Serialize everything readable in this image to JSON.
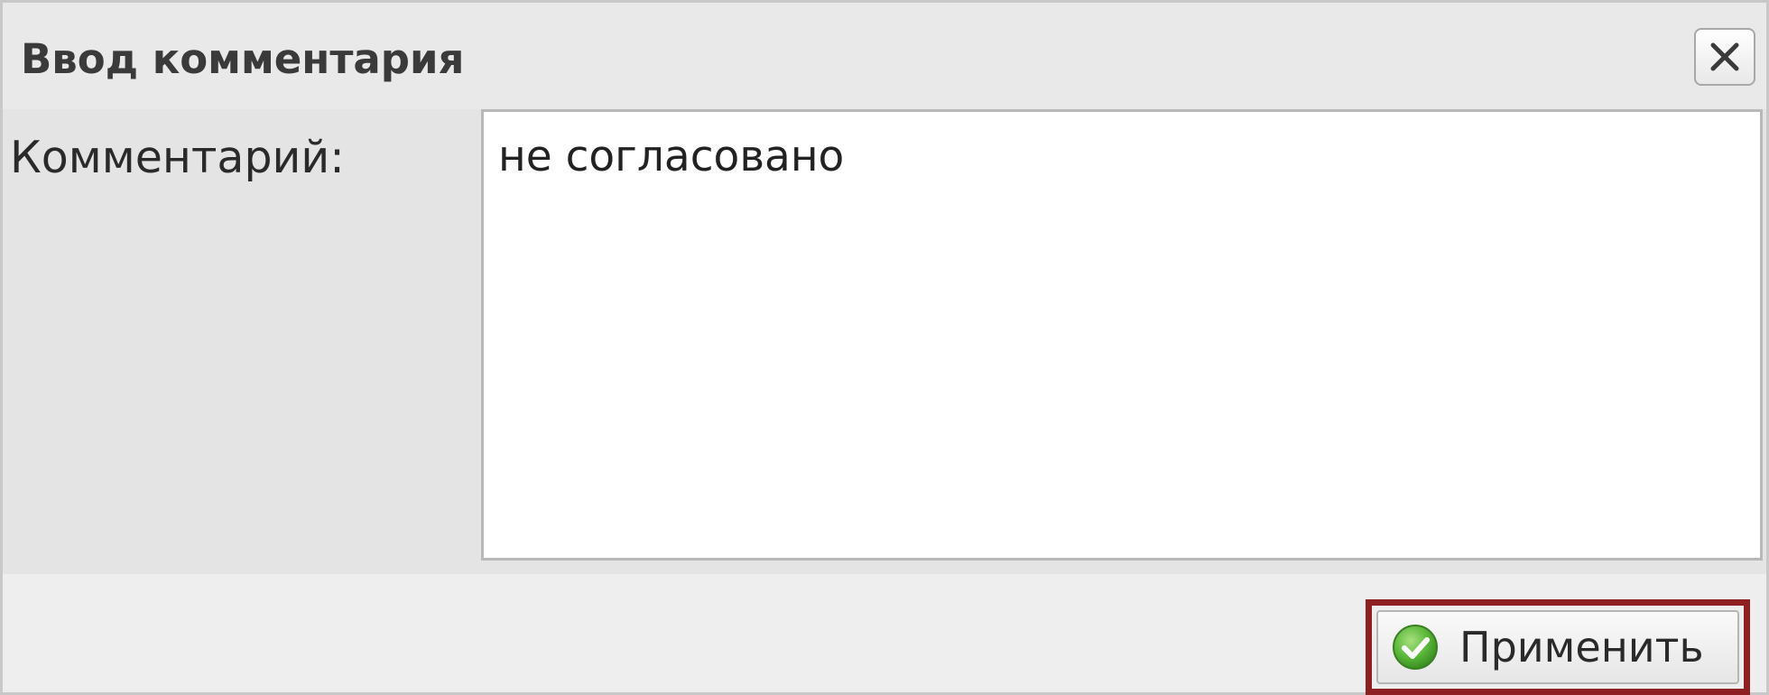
{
  "dialog": {
    "title": "Ввод комментария",
    "close_icon": "close-icon"
  },
  "form": {
    "comment_label": "Комментарий:",
    "comment_value": "не согласовано"
  },
  "footer": {
    "apply_label": "Применить",
    "apply_icon": "check-circle-icon",
    "apply_icon_color": "#4caf3a",
    "highlight_color": "#8e1f22"
  }
}
